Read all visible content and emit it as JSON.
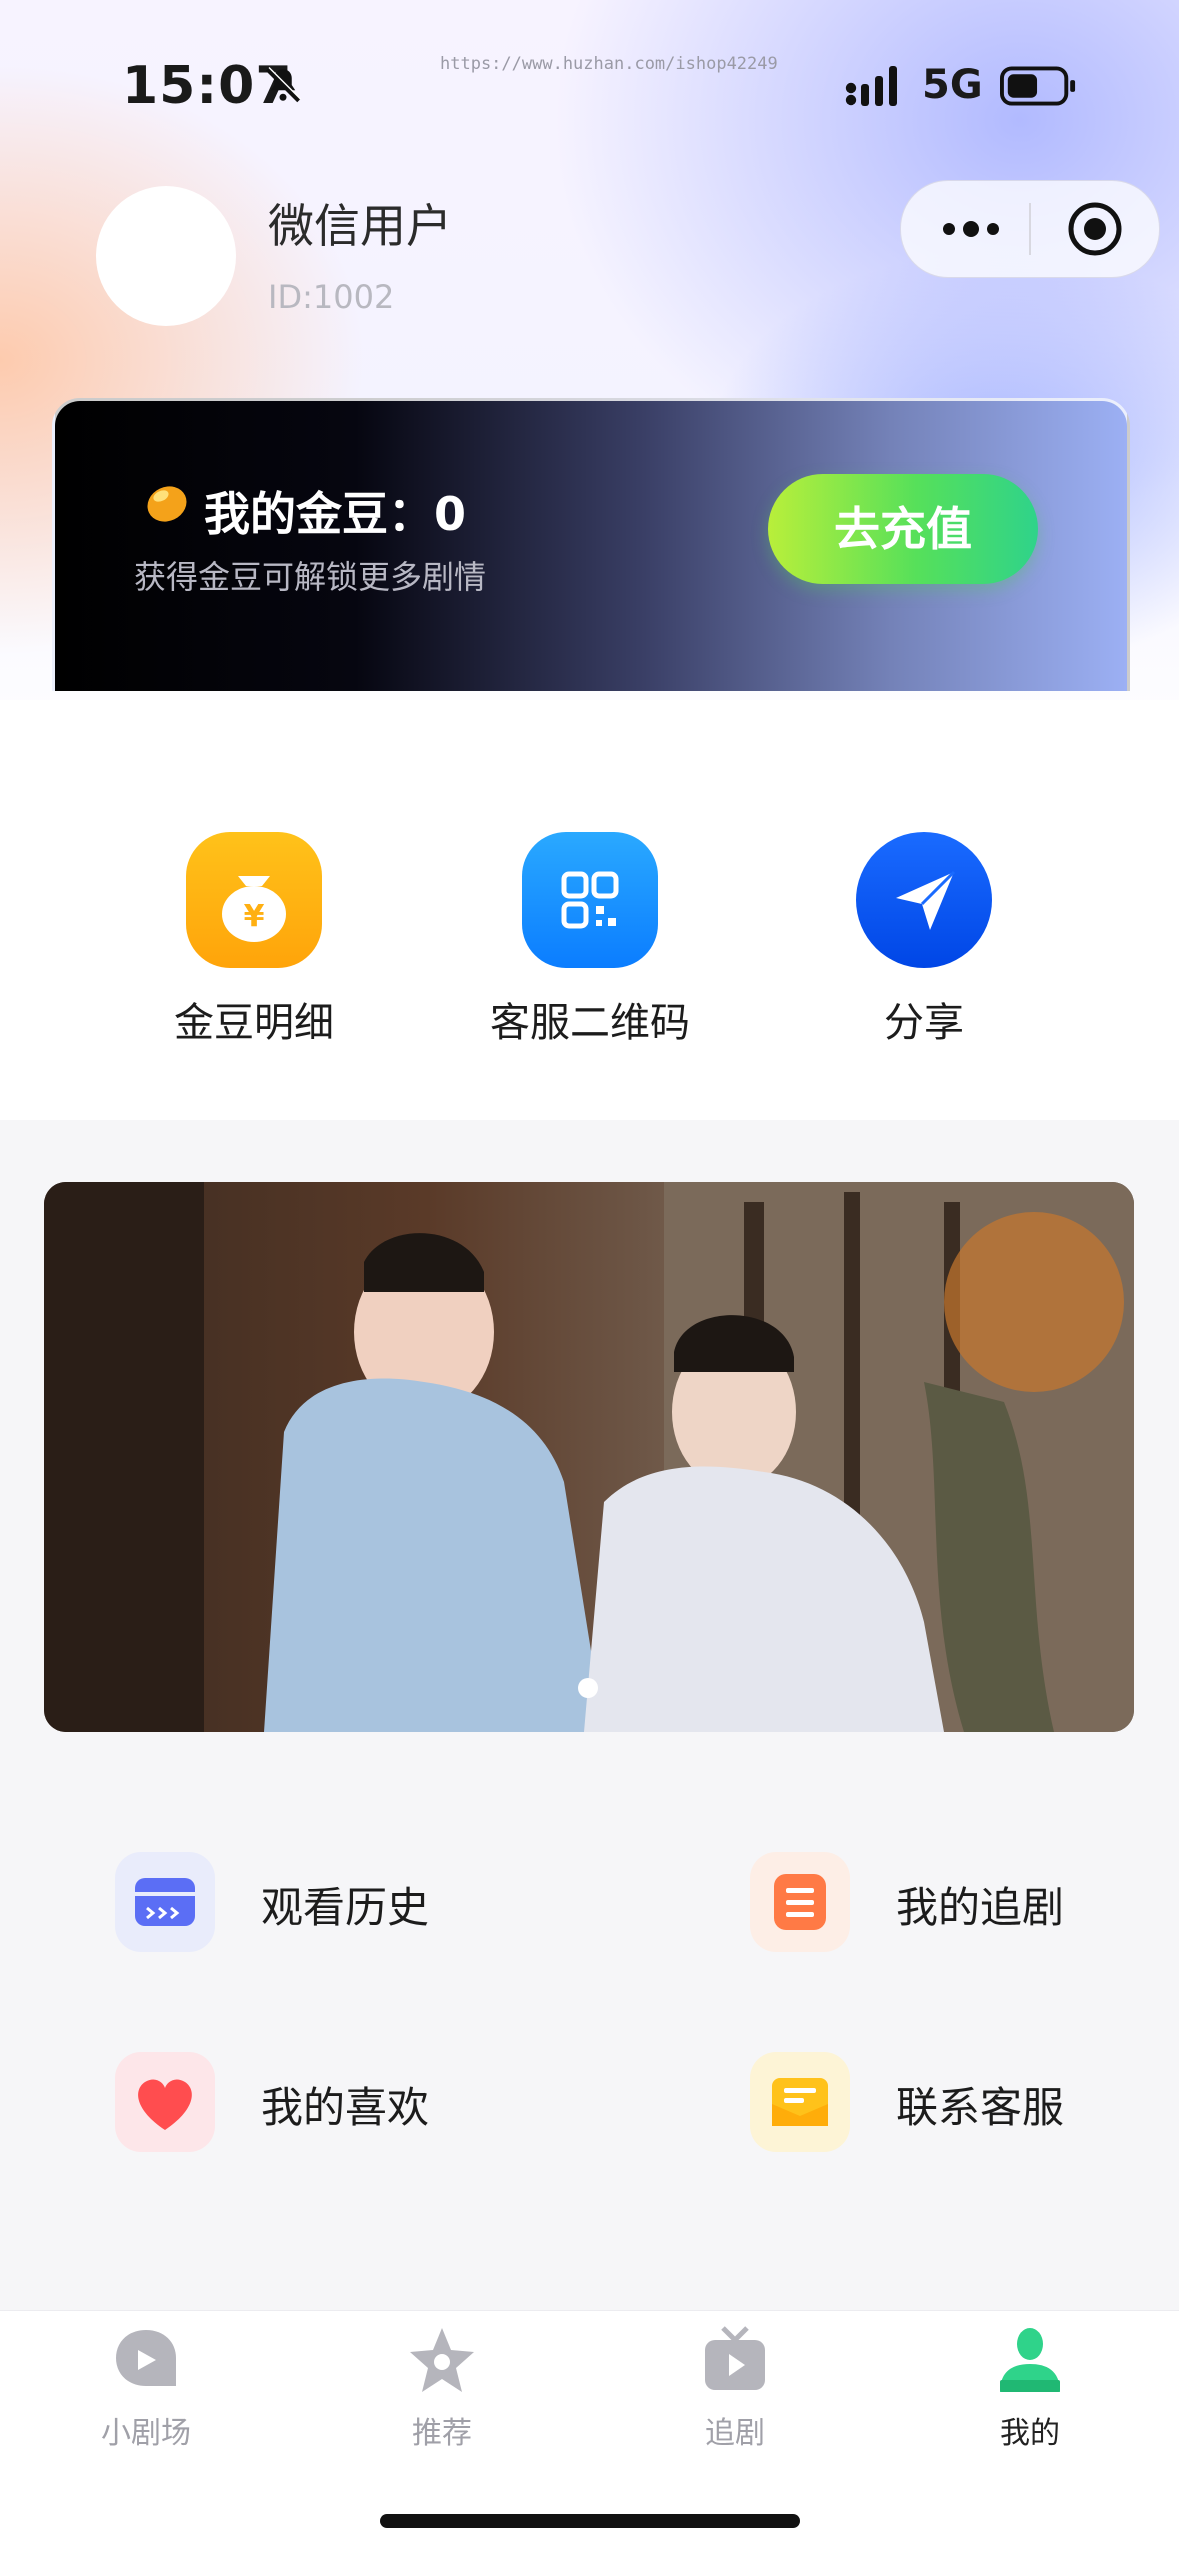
{
  "status_bar": {
    "time": "15:07",
    "network": "5G",
    "watermark": "https://www.huzhan.com/ishop42249"
  },
  "user": {
    "name": "微信用户",
    "id_text": "ID:1002"
  },
  "gold_card": {
    "title": "我的金豆：0",
    "subtitle": "获得金豆可解锁更多剧情",
    "recharge_label": "去充值"
  },
  "shortcuts": [
    {
      "label": "金豆明细",
      "icon": "coin-bag-icon"
    },
    {
      "label": "客服二维码",
      "icon": "qr-code-icon"
    },
    {
      "label": "分享",
      "icon": "share-paper-plane-icon"
    }
  ],
  "banner": {
    "slides": 1,
    "active_index": 0
  },
  "menu": [
    {
      "label": "观看历史",
      "icon": "history-icon"
    },
    {
      "label": "我的追剧",
      "icon": "following-list-icon"
    },
    {
      "label": "我的喜欢",
      "icon": "heart-icon"
    },
    {
      "label": "联系客服",
      "icon": "customer-service-icon"
    }
  ],
  "tabbar": {
    "items": [
      {
        "label": "小剧场",
        "icon": "theater-icon",
        "active": false
      },
      {
        "label": "推荐",
        "icon": "star-icon",
        "active": false
      },
      {
        "label": "追剧",
        "icon": "tv-icon",
        "active": false
      },
      {
        "label": "我的",
        "icon": "profile-icon",
        "active": true
      }
    ],
    "active_color": "#2fd38a",
    "inactive_color": "#a0a0a8"
  }
}
